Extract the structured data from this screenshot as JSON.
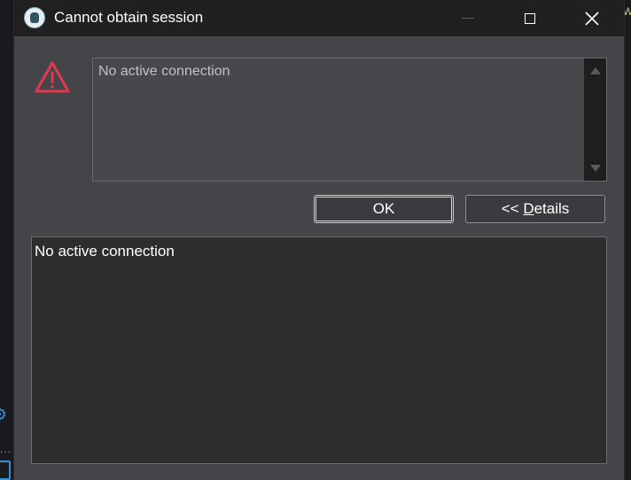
{
  "window": {
    "title": "Cannot obtain session"
  },
  "message": {
    "text": "No active connection"
  },
  "buttons": {
    "ok_label": "OK",
    "details_prefix": "<< ",
    "details_mnemonic": "D",
    "details_rest": "etails"
  },
  "details": {
    "text": "No active connection"
  },
  "background": {
    "edge_text": "W",
    "dots": "..."
  },
  "icons": {
    "app": "app-logo-icon",
    "warning": "warning-triangle-icon",
    "minimize": "minimize-icon",
    "maximize": "maximize-icon",
    "close": "close-icon"
  },
  "colors": {
    "warning": "#e0384e",
    "titlebar": "#202020",
    "dialog_bg": "#454549"
  }
}
